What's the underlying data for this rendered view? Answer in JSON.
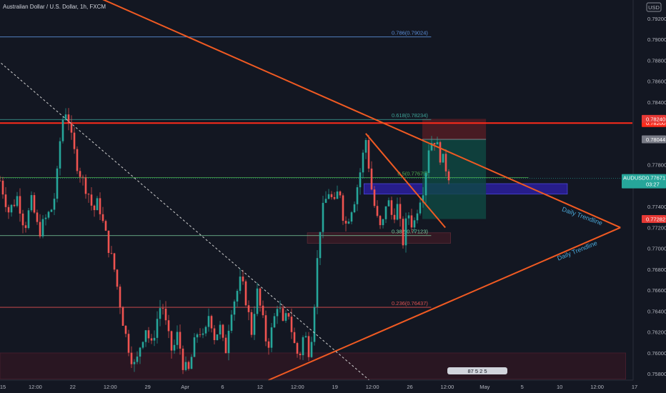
{
  "chart_data": {
    "type": "candlestick",
    "title": "Australian Dollar / U.S. Dollar, 1h, FXCM",
    "currency": "USD",
    "y_range": [
      0.7574,
      0.7935
    ],
    "y_ticks": [
      "0.79200",
      "0.79000",
      "0.78800",
      "0.78600",
      "0.78400",
      "0.77800",
      "0.77400",
      "0.77200",
      "0.77000",
      "0.76800",
      "0.76600",
      "0.76400",
      "0.76200",
      "0.76000",
      "0.75800"
    ],
    "x_ticks": [
      {
        "label": "15",
        "x": 0
      },
      {
        "label": "12:00",
        "x": 1
      },
      {
        "label": "22",
        "x": 2
      },
      {
        "label": "12:00",
        "x": 3
      },
      {
        "label": "29",
        "x": 4
      },
      {
        "label": "Apr",
        "x": 5
      },
      {
        "label": "6",
        "x": 6
      },
      {
        "label": "12",
        "x": 7
      },
      {
        "label": "12:00",
        "x": 8
      },
      {
        "label": "19",
        "x": 9
      },
      {
        "label": "12:00",
        "x": 10
      },
      {
        "label": "26",
        "x": 11
      },
      {
        "label": "12:00",
        "x": 12
      },
      {
        "label": "May",
        "x": 13
      },
      {
        "label": "5",
        "x": 14
      },
      {
        "label": "10",
        "x": 15
      },
      {
        "label": "12:00",
        "x": 16
      },
      {
        "label": "17",
        "x": 17
      }
    ],
    "price_path": [
      [
        0.0,
        0.7765
      ],
      [
        0.5,
        0.7735
      ],
      [
        1.0,
        0.775
      ],
      [
        1.4,
        0.772
      ],
      [
        1.8,
        0.7745
      ],
      [
        2.2,
        0.7715
      ],
      [
        2.6,
        0.7728
      ],
      [
        3.0,
        0.774
      ],
      [
        3.2,
        0.776
      ],
      [
        3.5,
        0.782
      ],
      [
        3.8,
        0.7835
      ],
      [
        4.1,
        0.78
      ],
      [
        4.4,
        0.778
      ],
      [
        4.7,
        0.7765
      ],
      [
        5.0,
        0.7755
      ],
      [
        5.3,
        0.7735
      ],
      [
        5.6,
        0.7745
      ],
      [
        5.9,
        0.772
      ],
      [
        6.2,
        0.77
      ],
      [
        6.5,
        0.768
      ],
      [
        6.8,
        0.765
      ],
      [
        7.1,
        0.762
      ],
      [
        7.4,
        0.76
      ],
      [
        7.7,
        0.7585
      ],
      [
        8.0,
        0.761
      ],
      [
        8.3,
        0.7625
      ],
      [
        8.6,
        0.7605
      ],
      [
        8.9,
        0.763
      ],
      [
        9.2,
        0.765
      ],
      [
        9.5,
        0.762
      ],
      [
        9.8,
        0.76
      ],
      [
        10.1,
        0.7618
      ],
      [
        10.4,
        0.759
      ],
      [
        10.7,
        0.758
      ],
      [
        11.0,
        0.7605
      ],
      [
        11.3,
        0.7625
      ],
      [
        11.6,
        0.761
      ],
      [
        11.9,
        0.764
      ],
      [
        12.2,
        0.7615
      ],
      [
        12.5,
        0.7625
      ],
      [
        12.8,
        0.7598
      ],
      [
        13.1,
        0.764
      ],
      [
        13.4,
        0.7655
      ],
      [
        13.7,
        0.767
      ],
      [
        14.0,
        0.765
      ],
      [
        14.3,
        0.762
      ],
      [
        14.6,
        0.766
      ],
      [
        14.9,
        0.7635
      ],
      [
        15.2,
        0.7605
      ],
      [
        15.5,
        0.7625
      ],
      [
        15.8,
        0.765
      ],
      [
        16.1,
        0.7625
      ],
      [
        16.4,
        0.764
      ],
      [
        16.7,
        0.761
      ],
      [
        17.0,
        0.7595
      ],
      [
        17.3,
        0.762
      ],
      [
        17.6,
        0.76
      ],
      [
        17.8,
        0.763
      ],
      [
        18.0,
        0.768
      ],
      [
        18.2,
        0.772
      ],
      [
        18.4,
        0.774
      ],
      [
        18.7,
        0.7755
      ],
      [
        19.0,
        0.774
      ],
      [
        19.3,
        0.776
      ],
      [
        19.6,
        0.772
      ],
      [
        19.9,
        0.7735
      ],
      [
        20.2,
        0.775
      ],
      [
        20.5,
        0.7775
      ],
      [
        20.8,
        0.7805
      ],
      [
        21.1,
        0.776
      ],
      [
        21.4,
        0.773
      ],
      [
        21.7,
        0.7715
      ],
      [
        22.0,
        0.775
      ],
      [
        22.3,
        0.773
      ],
      [
        22.6,
        0.774
      ],
      [
        22.9,
        0.7705
      ],
      [
        23.2,
        0.7735
      ],
      [
        23.5,
        0.772
      ],
      [
        23.8,
        0.7745
      ],
      [
        24.1,
        0.776
      ],
      [
        24.4,
        0.78
      ],
      [
        24.7,
        0.7805
      ],
      [
        25.0,
        0.779
      ],
      [
        25.3,
        0.778
      ],
      [
        25.6,
        0.7767
      ]
    ],
    "price_path_x_range": [
      0,
      25.6
    ],
    "current_price": {
      "label": "AUDUSD",
      "value": "0.77671",
      "countdown": "03:27"
    },
    "horizontal_lines": [
      {
        "label": "0.786(0.79024)",
        "value": 0.79024,
        "color": "#5b8dd6",
        "x_from": -1,
        "x_to": 24.5
      },
      {
        "label": "0.618(0.78234)",
        "value": 0.78234,
        "color": "#3fa59a",
        "x_from": -1,
        "x_to": 24.5
      },
      {
        "label": "0.5(0.77679)",
        "value": 0.77679,
        "color": "#4caf50",
        "x_from": -1,
        "x_to": 30
      },
      {
        "label": "0.382(0.77123)",
        "value": 0.77123,
        "color": "#7dcfa0",
        "x_from": -1,
        "x_to": 24.5
      },
      {
        "label": "0.236(0.76437)",
        "value": 0.76437,
        "color": "#e05252",
        "x_from": -1,
        "x_to": 24.5
      }
    ],
    "resistance_line": {
      "value": 0.782,
      "color": "#ff2b1a",
      "badge": "0.78200"
    },
    "price_badges": [
      {
        "value": 0.7824,
        "label": "0.78240",
        "color": "#e53935"
      },
      {
        "value": 0.78044,
        "label": "0.78044",
        "color": "#787b86"
      },
      {
        "value": 0.77282,
        "label": "0.77282",
        "color": "#e53935"
      }
    ],
    "trend_lines": [
      {
        "x1": -1,
        "y1": 0.799,
        "x2": 35.2,
        "y2": 0.772,
        "color": "#f05a22"
      },
      {
        "x1": 15.3,
        "y1": 0.7574,
        "x2": 35.2,
        "y2": 0.772,
        "color": "#f05a22"
      },
      {
        "x1": 20.8,
        "y1": 0.781,
        "x2": 25.3,
        "y2": 0.772,
        "color": "#f05a22"
      }
    ],
    "dashed_line": {
      "x1": 0,
      "y1": 0.788,
      "x2": 21.0,
      "y2": 0.7574,
      "color": "#d0d0d0"
    },
    "zones": [
      {
        "x1": 20.7,
        "y1": 0.7762,
        "x2": 32.2,
        "y2": 0.7752,
        "fill": "#2b1e9e",
        "stroke": "#4a46d8"
      },
      {
        "x1": 17.5,
        "y1": 0.7715,
        "x2": 25.6,
        "y2": 0.7705,
        "fill": "#3a1a24",
        "stroke": "#5a2a36"
      },
      {
        "x1": -1,
        "y1": 0.76,
        "x2": 35.5,
        "y2": 0.7575,
        "fill": "#2e1622",
        "stroke": "#4a2030"
      }
    ],
    "position_box": {
      "x1": 24.0,
      "x2": 27.6,
      "entry": 0.78044,
      "stop": 0.7824,
      "target": 0.77282
    },
    "annotations": [
      {
        "text": "Daily Trendline",
        "x": 33.0,
        "y": 0.7729,
        "angle": 20
      },
      {
        "text": "Daily Trendline",
        "x": 32.8,
        "y": 0.7696,
        "angle": -22
      }
    ],
    "bottom_marker": "87 5 2 5"
  }
}
